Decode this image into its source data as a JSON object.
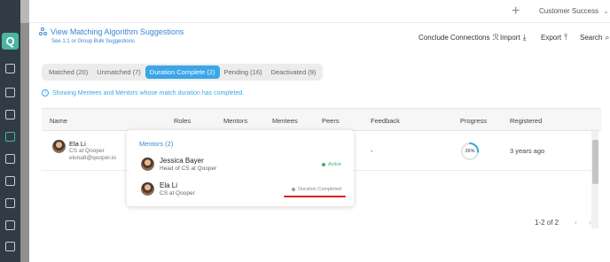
{
  "header": {
    "org_selector": "Customer Success",
    "plus_icon": "plus-icon",
    "chevron_icon": "chevron-down-icon"
  },
  "page": {
    "title": "View Matching Algorithm Suggestions",
    "subtitle": "See 1:1 or Group Bulk Suggestions",
    "title_icon": "algorithm-icon"
  },
  "actions": [
    {
      "label": "Conclude Connections",
      "icon": "conclude-icon",
      "glyph": "ℛ"
    },
    {
      "label": "Import",
      "icon": "import-icon",
      "glyph": "⤓"
    },
    {
      "label": "Export",
      "icon": "export-icon",
      "glyph": "⤒"
    },
    {
      "label": "Search",
      "icon": "search-icon",
      "glyph": "⌕"
    }
  ],
  "tabs": [
    {
      "label": "Matched (20)",
      "active": false
    },
    {
      "label": "Unmatched (7)",
      "active": false
    },
    {
      "label": "Duration Complete (2)",
      "active": true
    },
    {
      "label": "Pending (16)",
      "active": false
    },
    {
      "label": "Deactivated (9)",
      "active": false
    }
  ],
  "info": {
    "text": "Showing Mentees and Mentors whose match duration has completed.",
    "icon": "info-icon"
  },
  "table": {
    "columns": [
      "Name",
      "Roles",
      "Mentors",
      "Mentees",
      "Peers",
      "Feedback",
      "Progress",
      "Registered"
    ],
    "rows": [
      {
        "name": "Ela Li",
        "role": "CS at Qooper",
        "email": "elona8@qooper.io",
        "feedback": "-",
        "progress_percent": 26,
        "progress_label": "26%",
        "registered": "3 years ago"
      }
    ]
  },
  "pagination": {
    "text": "1-2 of 2",
    "prev_glyph": "‹",
    "next_glyph": "›"
  },
  "popover": {
    "title": "Mentors (2)",
    "mentors": [
      {
        "name": "Jessica Bayer",
        "role": "Head of CS at Qooper",
        "status": "Active",
        "status_color": "#3bb273"
      },
      {
        "name": "Ela Li",
        "role": "CS at Qooper",
        "status": "Duration Completed",
        "status_color": "#9aa0a6"
      }
    ]
  },
  "colors": {
    "accent": "#3aa6e8",
    "link": "#3a86d4",
    "sidebar": "#303b45",
    "brand": "#4ab5a0",
    "highlight_mark": "#e02020"
  }
}
